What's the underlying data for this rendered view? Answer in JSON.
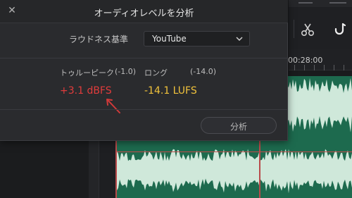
{
  "dialog": {
    "title": "オーディオレベルを分析",
    "close_icon": "close-icon",
    "normalization": {
      "label": "ラウドネス基準",
      "selected": "YouTube"
    },
    "true_peak": {
      "label": "トゥルーピーク",
      "reference": "(-1.0)",
      "value": "+3.1 dBFS"
    },
    "long_term": {
      "label": "ロング",
      "reference": "(-14.0)",
      "value": "-14.1 LUFS"
    },
    "analyze_label": "分析"
  },
  "timeline": {
    "timecode": "00:28:00"
  },
  "colors": {
    "peak_value": "#e23c3c",
    "lufs_value": "#f0c23c",
    "annotation_arrow": "#d23a3a",
    "waveform_track": "#1d6a4e",
    "waveform_fill": "#cfe8da"
  },
  "icons": [
    "close-icon",
    "chevron-down-icon",
    "razor-scissors-icon",
    "snap-hook-icon",
    "annotation-arrow-icon"
  ]
}
